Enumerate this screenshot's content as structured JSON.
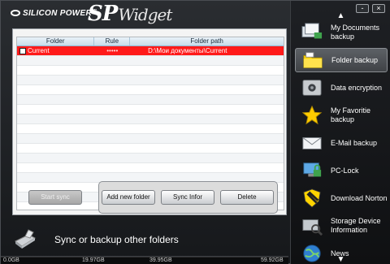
{
  "header": {
    "brand": "SILICON POWER",
    "brand_tm": "™",
    "logo_sp": "SP",
    "logo_widget": "Widget"
  },
  "table": {
    "columns": [
      "Folder",
      "Rule",
      "Folder path"
    ],
    "rows": [
      {
        "folder": "Current",
        "rule": "•••••",
        "path": "D:\\Мои документы\\Current",
        "selected": true,
        "checked": false
      }
    ],
    "empty_row_count": 16
  },
  "buttons": {
    "start_sync": "Start sync",
    "add_new_folder": "Add new folder",
    "sync_info": "Sync Infor",
    "delete": "Delete"
  },
  "footer": {
    "title": "Sync or backup other folders"
  },
  "storage": {
    "labels": [
      "0.0GB",
      "19.97GB",
      "39.95GB",
      "59.92GB"
    ]
  },
  "window_controls": {
    "minimize": "-",
    "close": "×"
  },
  "sidebar": {
    "items": [
      {
        "label": "My Documents backup",
        "icon": "documents-backup-icon",
        "active": false
      },
      {
        "label": "Folder backup",
        "icon": "folder-backup-icon",
        "active": true
      },
      {
        "label": "Data encryption",
        "icon": "safe-encryption-icon",
        "active": false
      },
      {
        "label": "My Favoritie backup",
        "icon": "star-favorite-icon",
        "active": false
      },
      {
        "label": "E-Mail backup",
        "icon": "envelope-icon",
        "active": false
      },
      {
        "label": "PC-Lock",
        "icon": "pc-lock-icon",
        "active": false
      },
      {
        "label": "Download Norton",
        "icon": "norton-shield-icon",
        "active": false
      },
      {
        "label": "Storage Device Information",
        "icon": "device-info-icon",
        "active": false
      },
      {
        "label": "News",
        "icon": "globe-icon",
        "active": false
      }
    ]
  },
  "colors": {
    "selected_row": "#ff1a1a",
    "accent": "#ffd400"
  }
}
